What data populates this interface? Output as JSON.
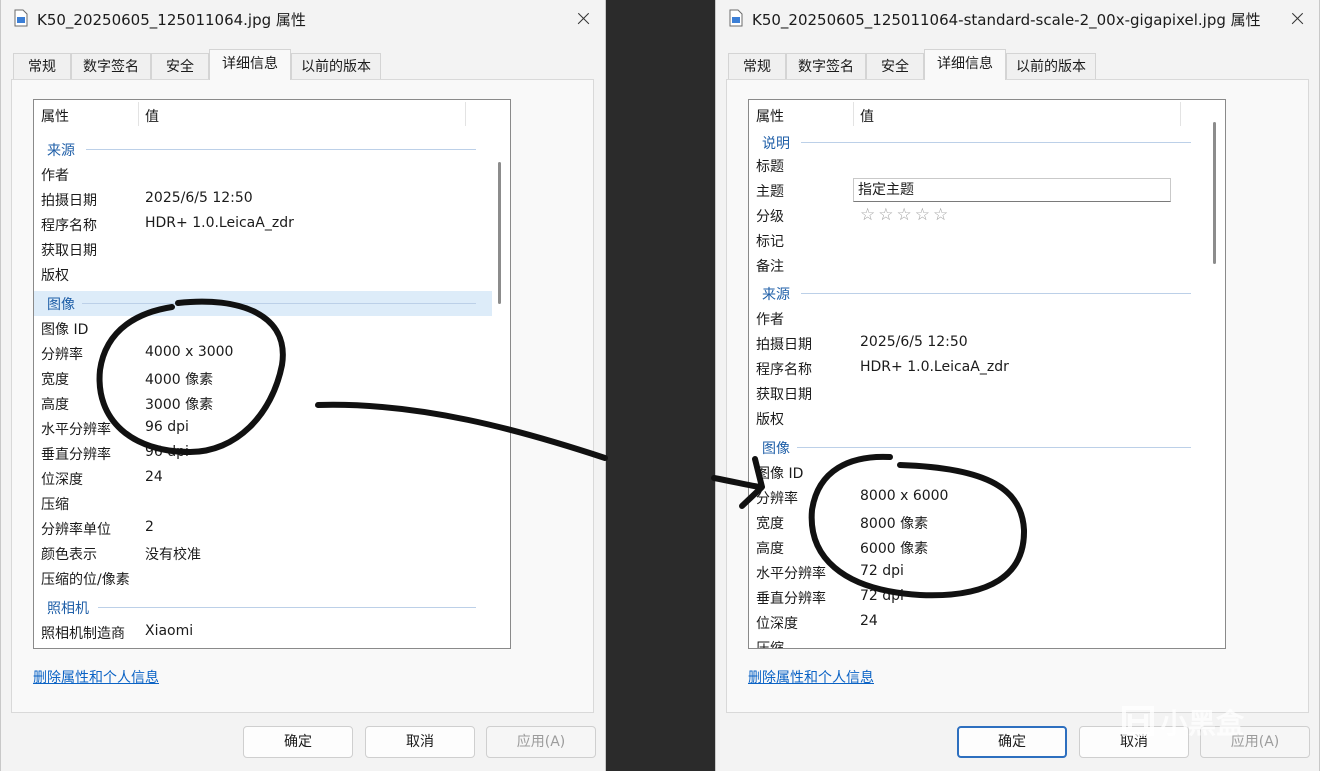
{
  "left": {
    "title": "K50_20250605_125011064.jpg 属性",
    "tabs": [
      "常规",
      "数字签名",
      "安全",
      "详细信息",
      "以前的版本"
    ],
    "header": {
      "property": "属性",
      "value": "值"
    },
    "groups": {
      "source": "来源",
      "image": "图像",
      "camera": "照相机"
    },
    "rows": {
      "author": {
        "k": "作者",
        "v": ""
      },
      "date_taken": {
        "k": "拍摄日期",
        "v": "2025/6/5 12:50"
      },
      "program": {
        "k": "程序名称",
        "v": "HDR+ 1.0.LeicaA_zdr"
      },
      "date_acquired": {
        "k": "获取日期",
        "v": ""
      },
      "copyright": {
        "k": "版权",
        "v": ""
      },
      "image_id": {
        "k": "图像 ID",
        "v": ""
      },
      "dimensions": {
        "k": "分辨率",
        "v": "4000 x 3000"
      },
      "width": {
        "k": "宽度",
        "v": "4000 像素"
      },
      "height": {
        "k": "高度",
        "v": "3000 像素"
      },
      "h_res": {
        "k": "水平分辨率",
        "v": "96 dpi"
      },
      "v_res": {
        "k": "垂直分辨率",
        "v": "96 dpi"
      },
      "bit_depth": {
        "k": "位深度",
        "v": "24"
      },
      "compression": {
        "k": "压缩",
        "v": ""
      },
      "res_unit": {
        "k": "分辨率单位",
        "v": "2"
      },
      "color_rep": {
        "k": "颜色表示",
        "v": "没有校准"
      },
      "compressed_bpp": {
        "k": "压缩的位/像素",
        "v": ""
      },
      "camera_maker": {
        "k": "照相机制造商",
        "v": "Xiaomi"
      }
    },
    "link": "删除属性和个人信息",
    "buttons": {
      "ok": "确定",
      "cancel": "取消",
      "apply": "应用(A)"
    }
  },
  "right": {
    "title": "K50_20250605_125011064-standard-scale-2_00x-gigapixel.jpg 属性",
    "tabs": [
      "常规",
      "数字签名",
      "安全",
      "详细信息",
      "以前的版本"
    ],
    "header": {
      "property": "属性",
      "value": "值"
    },
    "groups": {
      "description": "说明",
      "source": "来源",
      "image": "图像"
    },
    "rows": {
      "title": {
        "k": "标题",
        "v": ""
      },
      "subject": {
        "k": "主题",
        "v": "指定主题"
      },
      "rating": {
        "k": "分级",
        "v": "☆☆☆☆☆"
      },
      "tags": {
        "k": "标记",
        "v": ""
      },
      "comments": {
        "k": "备注",
        "v": ""
      },
      "author": {
        "k": "作者",
        "v": ""
      },
      "date_taken": {
        "k": "拍摄日期",
        "v": "2025/6/5 12:50"
      },
      "program": {
        "k": "程序名称",
        "v": "HDR+ 1.0.LeicaA_zdr"
      },
      "date_acquired": {
        "k": "获取日期",
        "v": ""
      },
      "copyright": {
        "k": "版权",
        "v": ""
      },
      "image_id": {
        "k": "图像 ID",
        "v": ""
      },
      "dimensions": {
        "k": "分辨率",
        "v": "8000 x 6000"
      },
      "width": {
        "k": "宽度",
        "v": "8000 像素"
      },
      "height": {
        "k": "高度",
        "v": "6000 像素"
      },
      "h_res": {
        "k": "水平分辨率",
        "v": "72 dpi"
      },
      "v_res": {
        "k": "垂直分辨率",
        "v": "72 dpi"
      },
      "bit_depth": {
        "k": "位深度",
        "v": "24"
      },
      "compression": {
        "k": "压缩",
        "v": ""
      }
    },
    "link": "删除属性和个人信息",
    "buttons": {
      "ok": "确定",
      "cancel": "取消",
      "apply": "应用(A)"
    }
  },
  "watermark": "小黑盒",
  "icons": {
    "file": "jpg-file-icon",
    "close": "close-icon",
    "stars": "star-outline-icon"
  },
  "colors": {
    "group_heading": "#1f5fa8",
    "link": "#0b63c5",
    "primary_border": "#2d6fbf",
    "annotation_ink": "#111111"
  }
}
